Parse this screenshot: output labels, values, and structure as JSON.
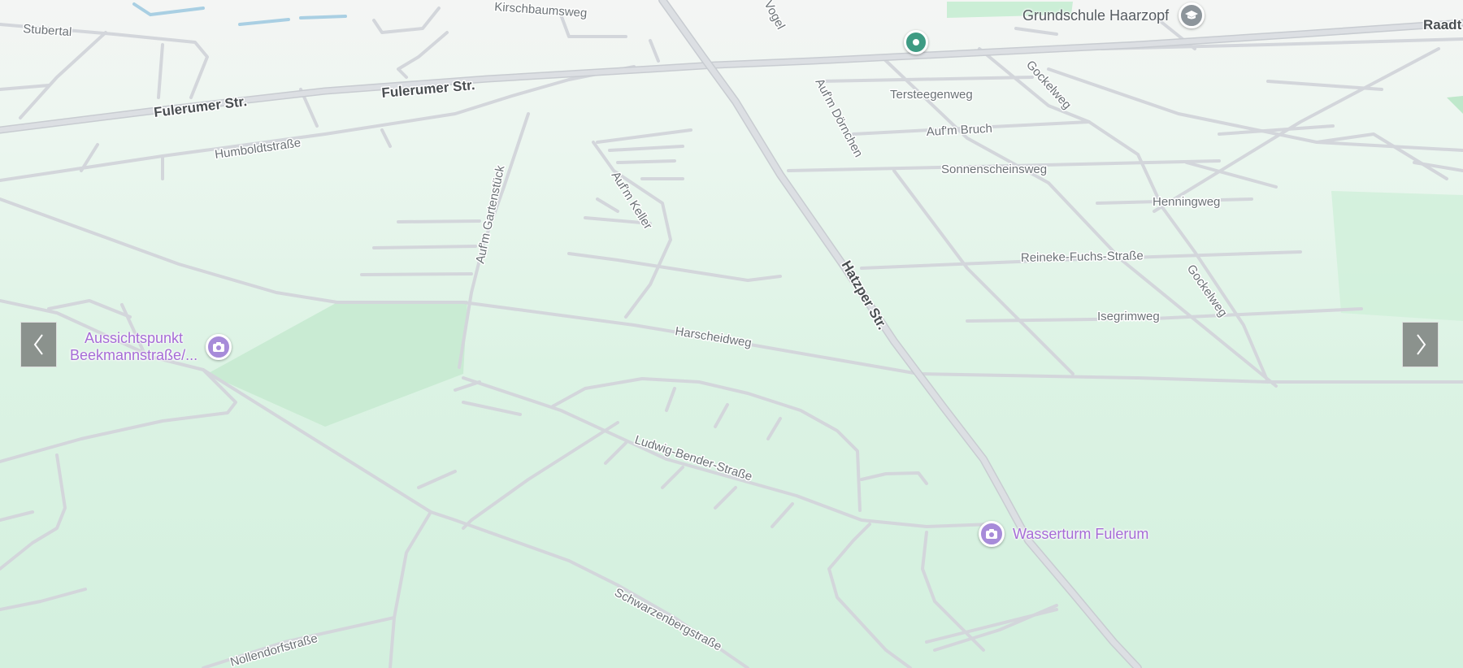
{
  "map": {
    "streets": {
      "stubertal": "Stubertal",
      "kirschbaumsweg": "Kirschbaumsweg",
      "fulerumer_str_1": "Fulerumer Str.",
      "fulerumer_str_2": "Fulerumer Str.",
      "humboldtstrasse": "Humboldtstraße",
      "aufm_gartenstueck": "Auf'm Gartenstück",
      "aufm_keller": "Auf'm Keller",
      "vogel": "Vogel",
      "aufm_doernchen": "Auf'm Dörnchen",
      "tersteegenweg": "Tersteegenweg",
      "aufm_bruch": "Auf'm Bruch",
      "sonnenscheinsweg": "Sonnenscheinsweg",
      "gockelweg_1": "Gockelweg",
      "gockelweg_2": "Gockelweg",
      "henningweg": "Henningweg",
      "reineke_fuchs_strasse": "Reineke-Fuchs-Straße",
      "isegrimweg": "Isegrimweg",
      "hatzper_str": "Hatzper Str.",
      "harscheidweg": "Harscheidweg",
      "ludwig_bender_strasse": "Ludwig-Bender-Straße",
      "schwarzenbergstrasse": "Schwarzenbergstraße",
      "nollendorfstrasse": "Nollendorfstraße",
      "raadt": "Raadt"
    },
    "pois": {
      "aussichtspunkt_line1": "Aussichtspunkt",
      "aussichtspunkt_line2": "Beekmannstraße/...",
      "wasserturm": "Wasserturm Fulerum",
      "grundschule": "Grundschule Haarzopf"
    },
    "icons": {
      "viewpoint": "camera-icon",
      "school": "graduation-cap-icon",
      "location": "location-pin-icon",
      "prev": "chevron-left-icon",
      "next": "chevron-right-icon"
    },
    "colors": {
      "poi_purple": "#a78bd9",
      "poi_label": "#a66cd6",
      "school_gray": "#8d959b",
      "pin_green": "#3e9b83",
      "road": "#d3d6db",
      "map_green": "#d6f1e0"
    }
  }
}
